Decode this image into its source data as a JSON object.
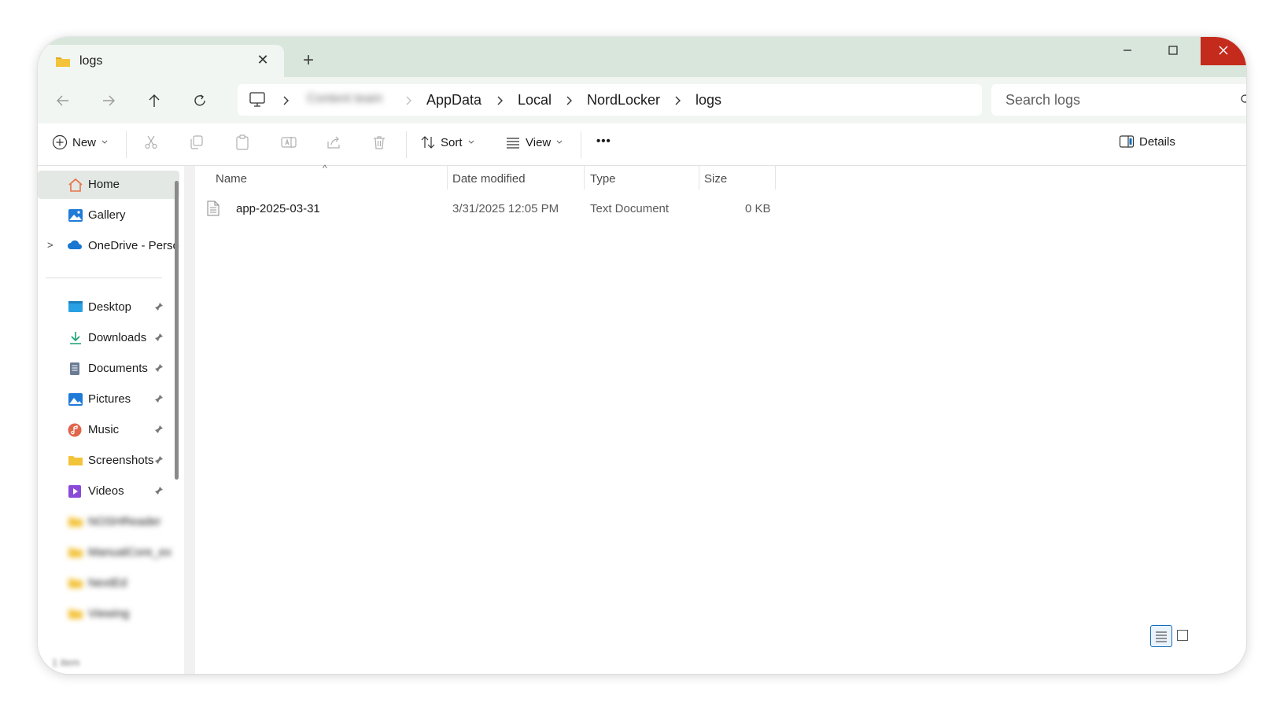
{
  "window": {
    "tab_title": "logs",
    "new_tab": "+",
    "close_tab": "✕"
  },
  "nav": {
    "breadcrumbs": [
      "AppData",
      "Local",
      "NordLocker",
      "logs"
    ],
    "blurred_crumb": "Content team",
    "search_placeholder": "Search logs"
  },
  "commands": {
    "new_label": "New",
    "sort_label": "Sort",
    "view_label": "View",
    "more_label": "•••",
    "details_label": "Details"
  },
  "sidebar": {
    "top_items": [
      {
        "label": "Home",
        "icon": "home-icon",
        "selected": true
      },
      {
        "label": "Gallery",
        "icon": "gallery-icon"
      },
      {
        "label": "OneDrive - Perso",
        "icon": "onedrive-icon",
        "expandable": true
      }
    ],
    "pinned_items": [
      {
        "label": "Desktop",
        "icon": "desktop-icon"
      },
      {
        "label": "Downloads",
        "icon": "downloads-icon"
      },
      {
        "label": "Documents",
        "icon": "documents-icon"
      },
      {
        "label": "Pictures",
        "icon": "pictures-icon"
      },
      {
        "label": "Music",
        "icon": "music-icon"
      },
      {
        "label": "Screenshots",
        "icon": "folder-icon"
      },
      {
        "label": "Videos",
        "icon": "videos-icon"
      }
    ],
    "blurred_items": [
      "NOSHReader",
      "ManualCore_ex",
      "NextEd",
      "Viewing"
    ]
  },
  "columns": {
    "name": "Name",
    "date": "Date modified",
    "type": "Type",
    "size": "Size"
  },
  "files": [
    {
      "name": "app-2025-03-31",
      "date": "3/31/2025 12:05 PM",
      "type": "Text Document",
      "size": "0 KB"
    }
  ],
  "status": {
    "item_count": "1 item"
  },
  "colors": {
    "titlebar": "#d9e6dc",
    "navbar": "#f1f6f2",
    "close_button": "#c42b1c",
    "folder_yellow": "#f3c33a",
    "accent_blue": "#0f6cbd"
  }
}
